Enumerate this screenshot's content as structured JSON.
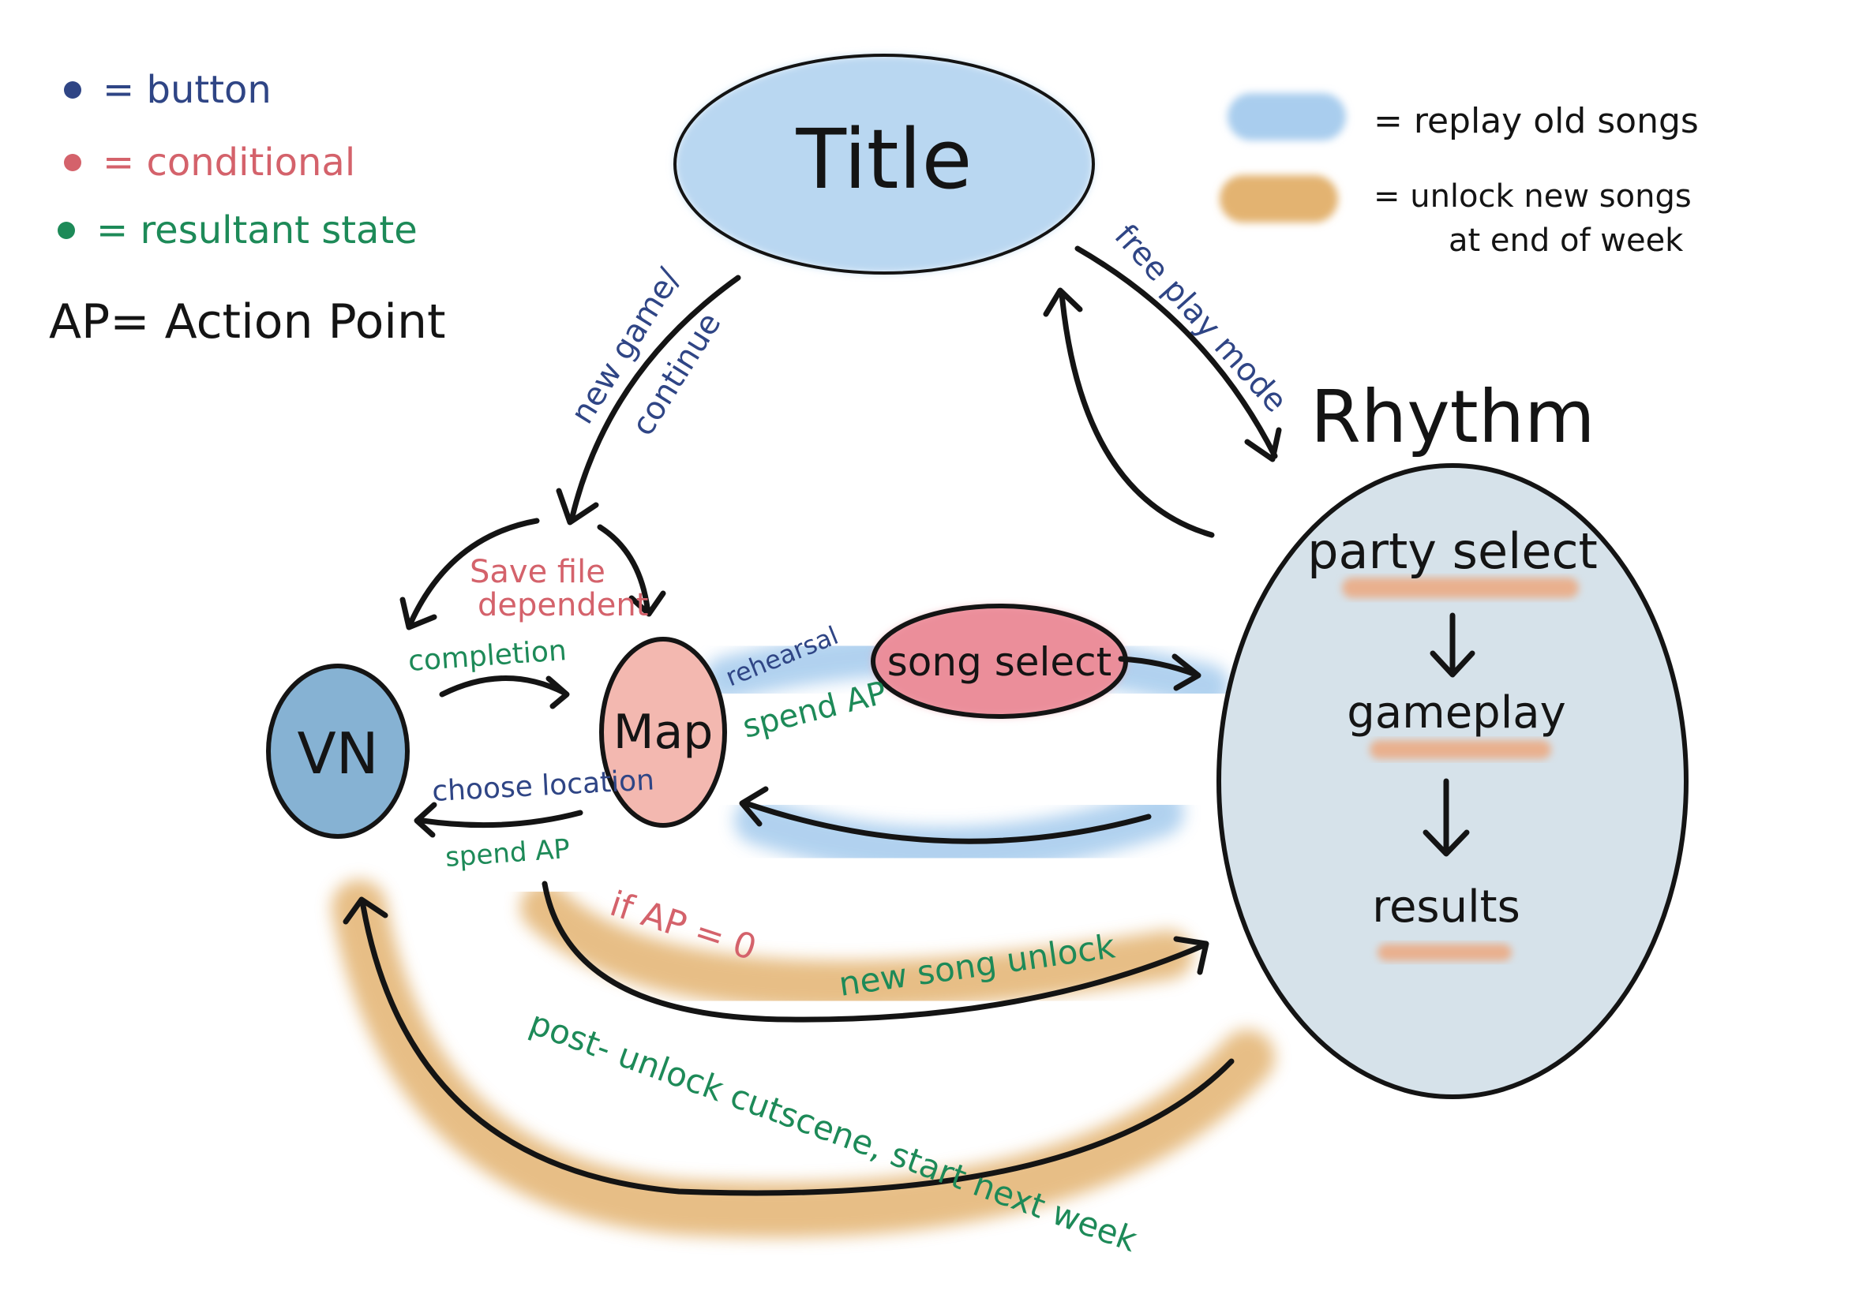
{
  "legend": {
    "button": "= button",
    "conditional": "= conditional",
    "resultant": "= resultant state",
    "ap": "AP= Action Point",
    "replay": "= replay old songs",
    "unlock_line1": "= unlock new songs",
    "unlock_line2": "at end of week"
  },
  "nodes": {
    "title": "Title",
    "vn": "VN",
    "map": "Map",
    "song_select": "song select",
    "rhythm": "Rhythm",
    "party_select": "party select",
    "gameplay": "gameplay",
    "results": "results"
  },
  "edges": {
    "new_game": "new game/",
    "continue": "continue",
    "free_play": "free play mode",
    "save_file_1": "Save file",
    "save_file_2": "dependent",
    "completion": "completion",
    "choose_location": "choose location",
    "spend_ap_vn": "spend AP",
    "rehearsal": "rehearsal",
    "spend_ap_map": "spend AP",
    "if_ap": "if AP = 0",
    "new_song_unlock": "new song unlock",
    "post_unlock": "post- unlock cutscene, start next week"
  },
  "colors": {
    "button": "#2f4585",
    "conditional": "#d4626b",
    "resultant": "#1d8a58",
    "replay": "#a9cdee",
    "unlock": "#e3b371",
    "ink": "#141414"
  }
}
